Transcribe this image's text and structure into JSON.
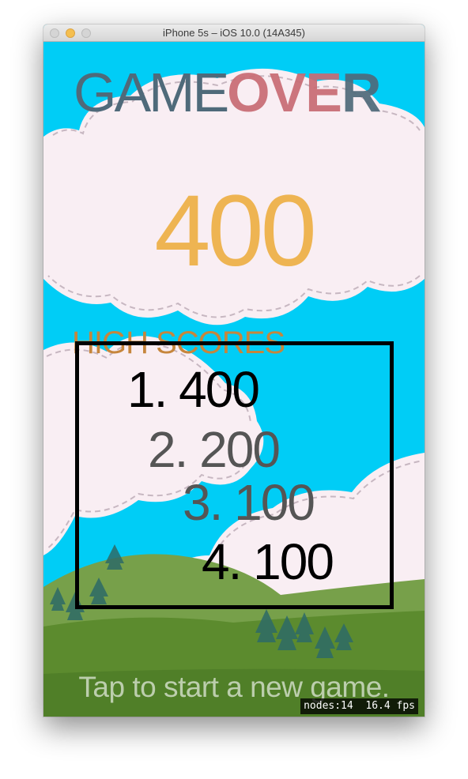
{
  "window": {
    "title": "iPhone 5s – iOS 10.0 (14A345)"
  },
  "game": {
    "title_part1": "GAME",
    "title_part2_pink": "OVE",
    "title_part2_slate": "R",
    "score": "400",
    "high_scores_heading": "HIGH SCORES",
    "high_scores": [
      {
        "rank": "1.",
        "score": "400"
      },
      {
        "rank": "2.",
        "score": "200"
      },
      {
        "rank": "3.",
        "score": "100"
      },
      {
        "rank": "4.",
        "score": "100"
      }
    ],
    "tap_message": "Tap to start a new game."
  },
  "debug": {
    "nodes": "nodes:14",
    "fps": "16.4 fps"
  },
  "colors": {
    "sky": "#00cdf6",
    "cloud": "#f9eef3",
    "hill": "#6d9a3c",
    "score": "#eeb452",
    "title_slate": "#4f6a7a",
    "title_pink": "#c86b74",
    "heading": "#c6863c"
  }
}
